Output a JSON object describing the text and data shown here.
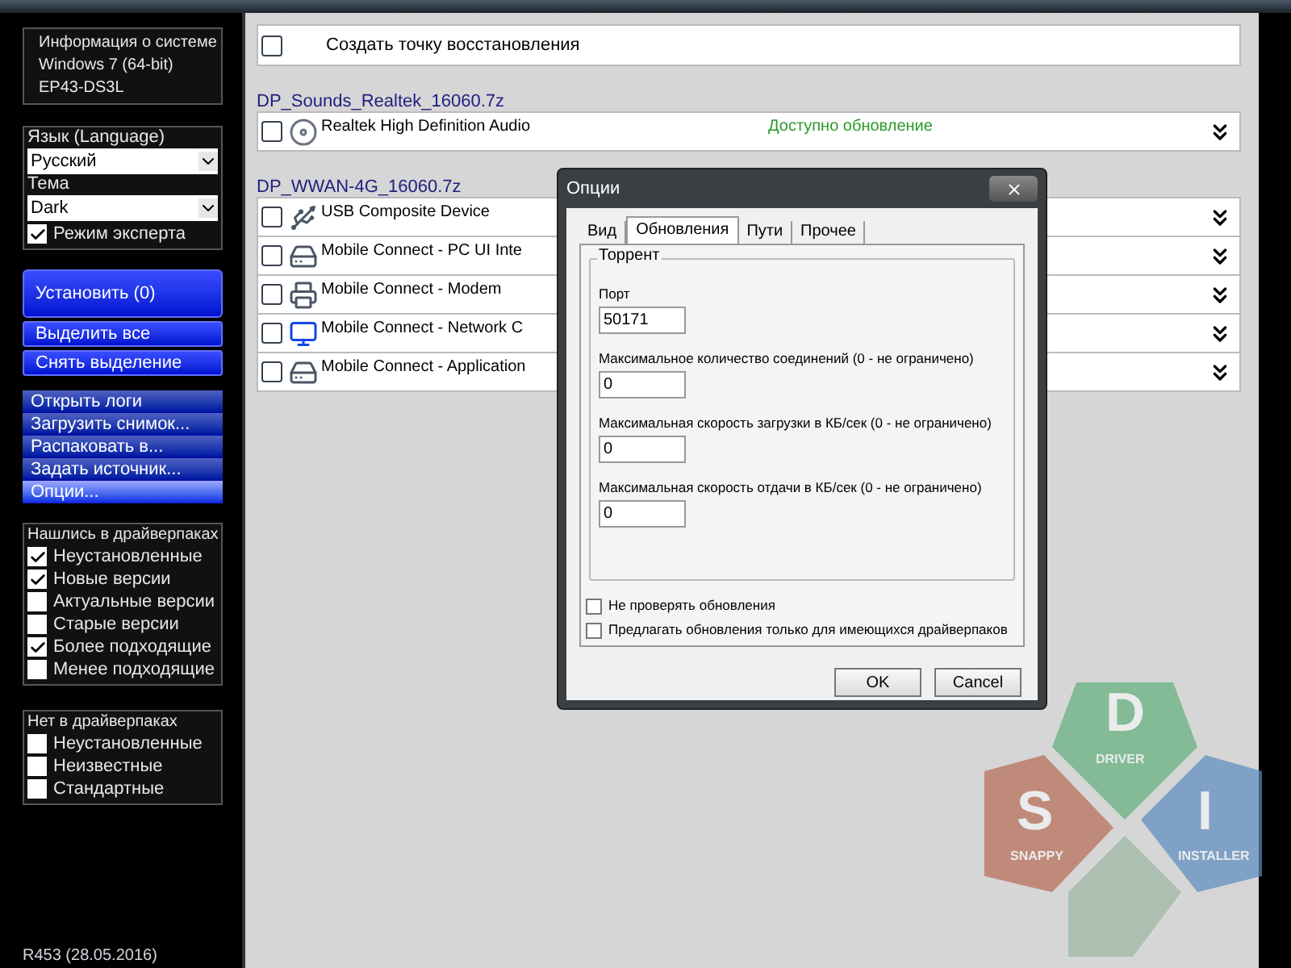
{
  "sysinfo": [
    "Информация о системе",
    "Windows 7 (64-bit)",
    "EP43-DS3L"
  ],
  "language": {
    "label": "Язык (Language)",
    "value": "Русский"
  },
  "theme": {
    "label": "Тема",
    "value": "Dark"
  },
  "expert_mode": {
    "label": "Режим эксперта",
    "checked": true
  },
  "install_button": "Установить (0)",
  "select_buttons": [
    "Выделить все",
    "Снять выделение"
  ],
  "menu": [
    {
      "label": "Открыть логи",
      "selected": false
    },
    {
      "label": "Загрузить снимок...",
      "selected": false
    },
    {
      "label": "Распаковать в...",
      "selected": false
    },
    {
      "label": "Задать источник...",
      "selected": false
    },
    {
      "label": "Опции...",
      "selected": true
    }
  ],
  "filters": [
    {
      "title": "Нашлись в драйверпаках",
      "items": [
        {
          "label": "Неустановленные",
          "checked": true
        },
        {
          "label": "Новые версии",
          "checked": true
        },
        {
          "label": "Актуальные версии",
          "checked": false
        },
        {
          "label": "Старые версии",
          "checked": false
        },
        {
          "label": "Более подходящие",
          "checked": true
        },
        {
          "label": "Менее подходящие",
          "checked": false
        }
      ]
    },
    {
      "title": "Нет в драйверпаках",
      "items": [
        {
          "label": "Неустановленные",
          "checked": false
        },
        {
          "label": "Неизвестные",
          "checked": false
        },
        {
          "label": "Стандартные",
          "checked": false
        }
      ]
    }
  ],
  "version": "R453 (28.05.2016)",
  "restore_point": {
    "label": "Создать точку восстановления",
    "checked": false
  },
  "driver_packs": [
    {
      "name": "DP_Sounds_Realtek_16060.7z",
      "drivers": [
        {
          "name": "Realtek High Definition Audio",
          "status": "Доступно обновление",
          "checked": false,
          "kind": "disc"
        }
      ]
    },
    {
      "name": "DP_WWAN-4G_16060.7z",
      "drivers": [
        {
          "name": "USB Composite Device",
          "checked": false,
          "kind": "usb"
        },
        {
          "name": "Mobile Connect - PC UI Inte",
          "checked": false,
          "kind": "drive"
        },
        {
          "name": "Mobile Connect - Modem",
          "checked": false,
          "kind": "printer"
        },
        {
          "name": "Mobile Connect - Network C",
          "checked": false,
          "kind": "network"
        },
        {
          "name": "Mobile Connect - Application",
          "checked": false,
          "kind": "drive"
        }
      ]
    }
  ],
  "dialog": {
    "title": "Опции",
    "tabs": [
      {
        "label": "Вид",
        "selected": false
      },
      {
        "label": "Обновления",
        "selected": true
      },
      {
        "label": "Пути",
        "selected": false
      },
      {
        "label": "Прочее",
        "selected": false
      }
    ],
    "group": "Торрент",
    "fields": [
      {
        "label": "Порт",
        "value": "50171"
      },
      {
        "label": "Максимальное количество соединений (0 - не ограничено)",
        "value": "0"
      },
      {
        "label": "Максимальная скорость загрузки в КБ/сек (0 - не ограничено)",
        "value": "0"
      },
      {
        "label": "Максимальная скорость отдачи в КБ/сек (0 - не ограничено)",
        "value": "0"
      }
    ],
    "checkboxes": [
      {
        "label": "Не проверять обновления",
        "checked": false
      },
      {
        "label": "Предлагать обновления только для имеющихся драйверпаков",
        "checked": false
      }
    ],
    "buttons": [
      "OK",
      "Cancel"
    ]
  },
  "logo": {
    "letters": [
      "D",
      "S",
      "I"
    ],
    "words": [
      "DRIVER",
      "SNAPPY",
      "INSTALLER"
    ]
  }
}
